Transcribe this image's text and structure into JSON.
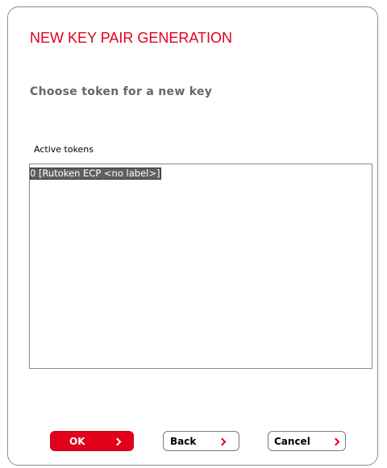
{
  "dialog": {
    "title": "NEW KEY PAIR GENERATION",
    "subtitle": "Choose token for a new key"
  },
  "tokens": {
    "label": "Active tokens",
    "items": [
      {
        "text": "0 [Rutoken ECP <no label>]",
        "selected": true
      }
    ]
  },
  "buttons": {
    "ok": "OK",
    "back": "Back",
    "cancel": "Cancel"
  },
  "colors": {
    "accent": "#e2001a",
    "subtitle": "#666666",
    "selection": "#606060"
  },
  "icons": {
    "button_arrow": "chevron-right-icon"
  }
}
